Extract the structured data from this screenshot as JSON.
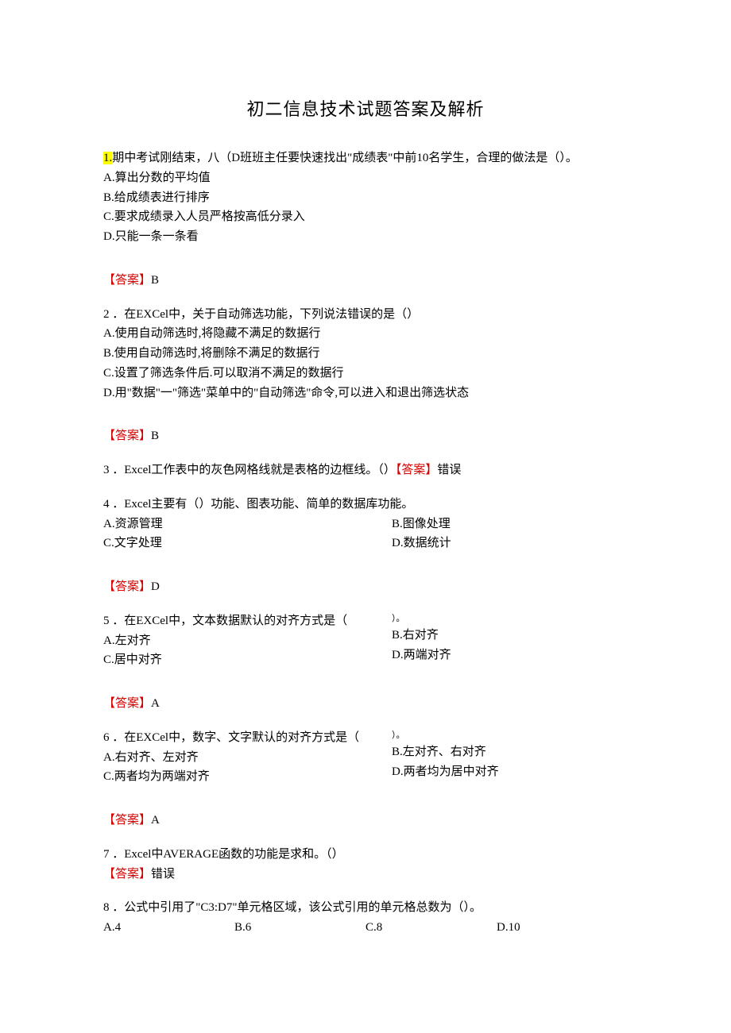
{
  "title": "初二信息技术试题答案及解析",
  "q1": {
    "num": "1.",
    "stem": "期中考试刚结束，八（D班班主任要快速找出\"成绩表\"中前10名学生，合理的做法是（）。",
    "a": "A.算出分数的平均值",
    "b": "B.给成绩表进行排序",
    "c": "C.要求成绩录入人员严格按高低分录入",
    "d": "D.只能一条一条看",
    "ans_label": "【答案】",
    "ans": "B"
  },
  "q2": {
    "stem": "2 ．在EXCel中，关于自动筛选功能，下列说法错误的是（）",
    "a": "A.使用自动筛选时,将隐藏不满足的数据行",
    "b": "B.使用自动筛选时,将删除不满足的数据行",
    "c": "C.设置了筛选条件后.可以取消不满足的数据行",
    "d": "D.用\"数据\"一\"筛选\"菜单中的\"自动筛选\"命令,可以进入和退出筛选状态",
    "ans_label": "【答案】",
    "ans": "B"
  },
  "q3": {
    "stem": "3 ．Excel工作表中的灰色网格线就是表格的边框线。（）",
    "ans_label": "【答案】",
    "ans": "错误"
  },
  "q4": {
    "stem": "4 ．Excel主要有（）功能、图表功能、简单的数据库功能。",
    "a": "A.资源管理",
    "b": "B.图像处理",
    "c": "C.文字处理",
    "d": "D.数据统计",
    "ans_label": "【答案】",
    "ans": "D"
  },
  "q5": {
    "stem": "5 ．在EXCel中，文本数据默认的对齐方式是（",
    "tail": "）。",
    "a": "A.左对齐",
    "b": "B.右对齐",
    "c": "C.居中对齐",
    "d": "D.两端对齐",
    "ans_label": "【答案】",
    "ans": "A"
  },
  "q6": {
    "stem": "6 ．在EXCel中，数字、文字默认的对齐方式是（",
    "tail": "）。",
    "a": "A.右对齐、左对齐",
    "b": "B.左对齐、右对齐",
    "c": "C.两者均为两端对齐",
    "d": "D.两者均为居中对齐",
    "ans_label": "【答案】",
    "ans": "A"
  },
  "q7": {
    "stem": "7 ．Excel中AVERAGE函数的功能是求和。（）",
    "ans_label": "【答案】",
    "ans": "错误"
  },
  "q8": {
    "stem": "8 ．公式中引用了\"C3:D7\"单元格区域，该公式引用的单元格总数为（）。",
    "a": "A.4",
    "b": "B.6",
    "c": "C.8",
    "d": "D.10"
  }
}
